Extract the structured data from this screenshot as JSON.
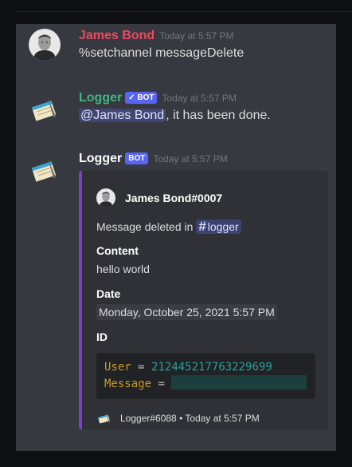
{
  "messages": [
    {
      "author": "James Bond",
      "author_color": "#f04760",
      "timestamp": "Today at 5:57 PM",
      "content": "%setchannel messageDelete"
    },
    {
      "author": "Logger",
      "author_color": "#43b581",
      "bot_badge": "✓ BOT",
      "timestamp": "Today at 5:57 PM",
      "mention": "@James Bond",
      "content_rest": ", it has been done."
    },
    {
      "author": "Logger",
      "author_color": "#ffffff",
      "bot_badge": "BOT",
      "timestamp": "Today at 5:57 PM",
      "embed": {
        "accent_color": "#7c3fd6",
        "author": "James Bond#0007",
        "description_prefix": "Message deleted in ",
        "channel": "logger",
        "channel_hash": "#",
        "fields": [
          {
            "name": "Content",
            "value": "hello world"
          },
          {
            "name": "Date",
            "value": "Monday, October 25, 2021 5:57 PM"
          },
          {
            "name": "ID"
          }
        ],
        "code": {
          "user_key": "User",
          "eq": "=",
          "user_value": "212445217763229699",
          "message_key": "Message"
        },
        "footer": "Logger#6088 • Today at 5:57 PM"
      }
    }
  ],
  "icons": [
    "james-bond-avatar-icon",
    "logger-notepad-icon"
  ]
}
